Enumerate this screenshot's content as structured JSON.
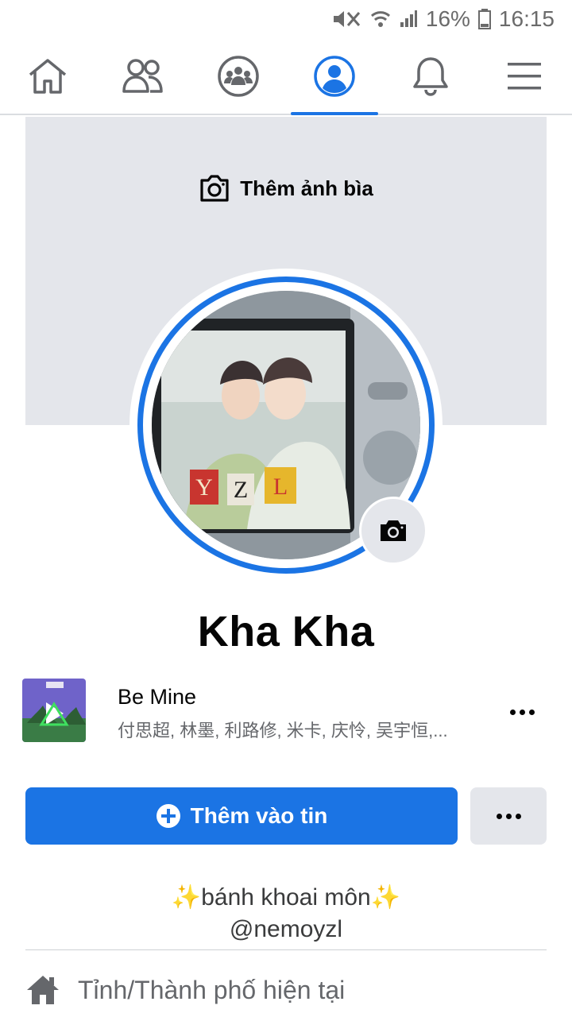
{
  "status_bar": {
    "battery": "16%",
    "time": "16:15"
  },
  "nav": {
    "tabs": [
      "home-icon",
      "friends-icon",
      "groups-icon",
      "profile-icon",
      "notifications-icon",
      "menu-icon"
    ],
    "active_index": 3,
    "active_color": "#1b74e4"
  },
  "cover": {
    "add_cover_label": "Thêm ảnh bìa"
  },
  "profile": {
    "name": "Kha Kha"
  },
  "music": {
    "title": "Be Mine",
    "artists": "付思超, 林墨, 利路修, 米卡, 庆怜, 吴宇恒,..."
  },
  "actions": {
    "add_story_label": "Thêm vào tin"
  },
  "bio": {
    "line1": "✨bánh khoai môn✨",
    "line2": "@nemoyzl"
  },
  "details": {
    "location_label": "Tỉnh/Thành phố hiện tại"
  }
}
